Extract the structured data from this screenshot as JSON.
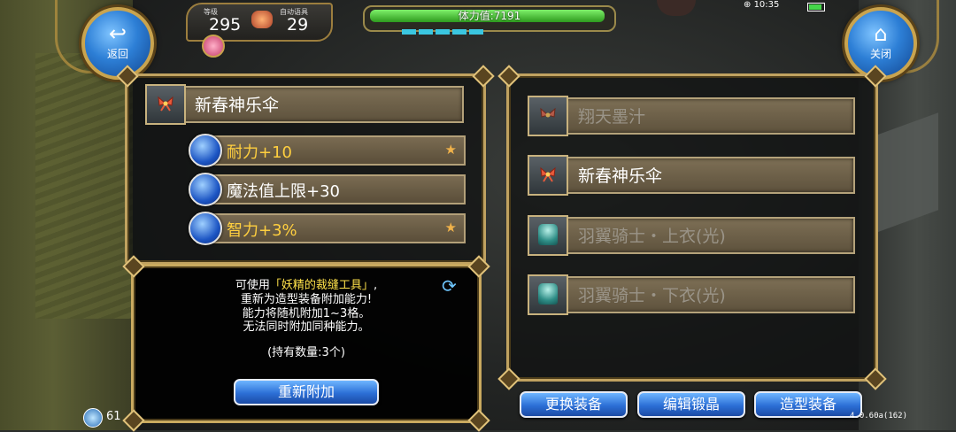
{
  "buttons": {
    "back": "返回",
    "close": "关闭",
    "reattach": "重新附加",
    "change_equipment": "更换装备",
    "edit_crystal": "编辑锻晶",
    "appearance_equipment": "造型装备"
  },
  "status": {
    "level_label": "等级",
    "level": "295",
    "auto_label": "自动语具",
    "auto_value": "29",
    "stamina_label": "体力值:7191",
    "stamina_fraction": 0.98,
    "time": "10:35"
  },
  "left_panel": {
    "selected_item": "新春神乐伞",
    "stats": [
      {
        "label": "耐力+10",
        "starred": true
      },
      {
        "label": "魔法值上限+30",
        "starred": false
      },
      {
        "label": "智力+3%",
        "starred": true
      }
    ]
  },
  "info": {
    "line1_prefix": "可使用",
    "line1_highlight": "「妖精的裁缝工具」",
    "line1_suffix": ",",
    "line2": "重新为造型装备附加能力!",
    "line3": "能力将随机附加1~3格。",
    "line4": "无法同时附加同种能力。",
    "owned": "(持有数量:3个)"
  },
  "right_panel": {
    "items": [
      {
        "label": "翔天墨汁",
        "icon": "ribbon-icon",
        "dim": true
      },
      {
        "label": "新春神乐伞",
        "icon": "ribbon-icon",
        "dim": false
      },
      {
        "label": "羽翼骑士・上衣(光)",
        "icon": "armor-top-icon",
        "dim": true
      },
      {
        "label": "羽翼骑士・下衣(光)",
        "icon": "armor-bottom-icon",
        "dim": true
      }
    ]
  },
  "hud": {
    "left_value": "61",
    "version": "4.0.60a(162)"
  }
}
